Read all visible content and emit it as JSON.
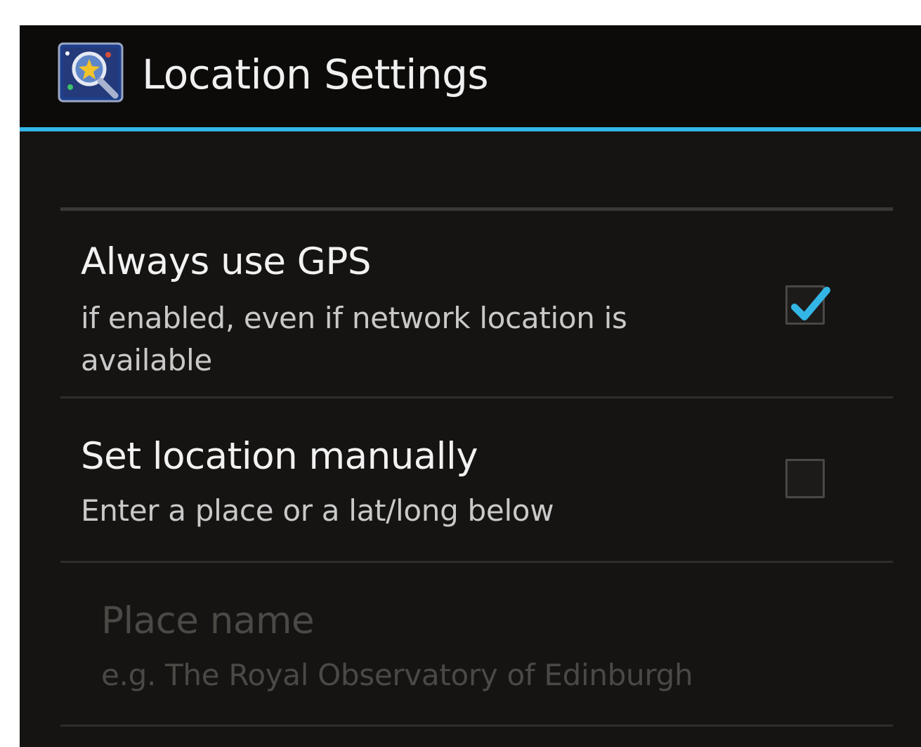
{
  "action_bar": {
    "title": "Location Settings",
    "icon": "sky-map-app-icon",
    "accent_color": "#33b5e5"
  },
  "preferences": [
    {
      "title": "Always use GPS",
      "summary": "if enabled, even if network location is available",
      "checked": true
    },
    {
      "title": "Set location manually",
      "summary": "Enter a place or a lat/long below",
      "checked": false
    },
    {
      "title": "Place name",
      "summary": "e.g. The Royal Observatory of Edinburgh",
      "enabled": false
    }
  ],
  "colors": {
    "background": "#161412",
    "action_bar": "#0c0b0a",
    "checkmark": "#33b5e5",
    "disabled_text": "#4b4845"
  }
}
